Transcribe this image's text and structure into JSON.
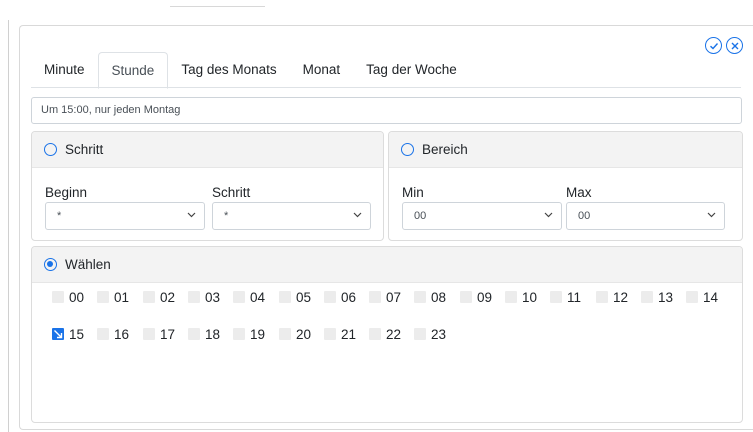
{
  "actions": {
    "confirm_icon": "check-circle-icon",
    "close_icon": "close-circle-icon",
    "accent": "#1a73e8"
  },
  "tabs": [
    {
      "label": "Minute"
    },
    {
      "label": "Stunde",
      "active": true
    },
    {
      "label": "Tag des Monats"
    },
    {
      "label": "Monat"
    },
    {
      "label": "Tag der Woche"
    }
  ],
  "summary": {
    "value": "Um 15:00, nur jeden Montag"
  },
  "schritt_panel": {
    "title": "Schritt",
    "selected": false,
    "begin_label": "Beginn",
    "begin_value": "*",
    "step_label": "Schritt",
    "step_value": "*"
  },
  "bereich_panel": {
    "title": "Bereich",
    "selected": false,
    "min_label": "Min",
    "min_value": "00",
    "max_label": "Max",
    "max_value": "00"
  },
  "waehlen_panel": {
    "title": "Wählen",
    "selected": true,
    "hours": [
      {
        "label": "00",
        "checked": false
      },
      {
        "label": "01",
        "checked": false
      },
      {
        "label": "02",
        "checked": false
      },
      {
        "label": "03",
        "checked": false
      },
      {
        "label": "04",
        "checked": false
      },
      {
        "label": "05",
        "checked": false
      },
      {
        "label": "06",
        "checked": false
      },
      {
        "label": "07",
        "checked": false
      },
      {
        "label": "08",
        "checked": false
      },
      {
        "label": "09",
        "checked": false
      },
      {
        "label": "10",
        "checked": false
      },
      {
        "label": "11",
        "checked": false
      },
      {
        "label": "12",
        "checked": false
      },
      {
        "label": "13",
        "checked": false
      },
      {
        "label": "14",
        "checked": false
      },
      {
        "label": "15",
        "checked": true
      },
      {
        "label": "16",
        "checked": false
      },
      {
        "label": "17",
        "checked": false
      },
      {
        "label": "18",
        "checked": false
      },
      {
        "label": "19",
        "checked": false
      },
      {
        "label": "20",
        "checked": false
      },
      {
        "label": "21",
        "checked": false
      },
      {
        "label": "22",
        "checked": false
      },
      {
        "label": "23",
        "checked": false
      }
    ]
  }
}
